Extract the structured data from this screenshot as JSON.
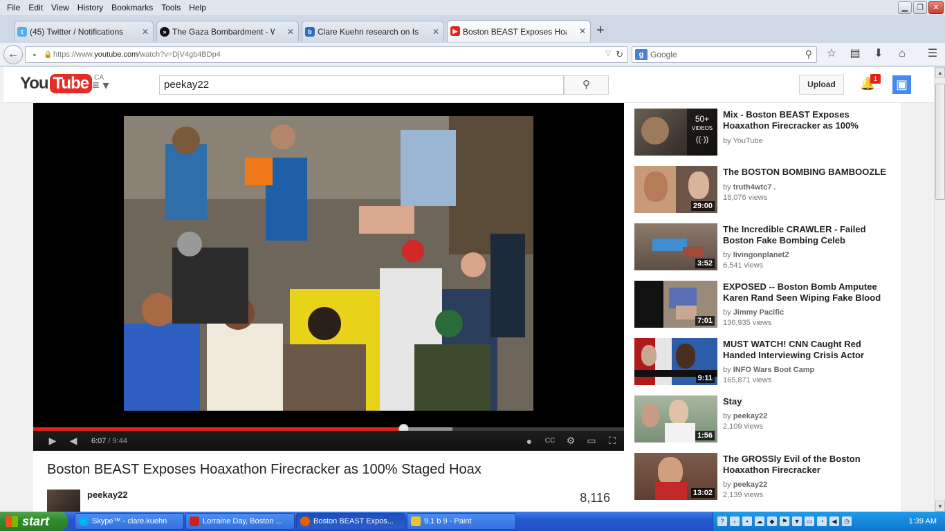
{
  "menubar": {
    "items": [
      "File",
      "Edit",
      "View",
      "History",
      "Bookmarks",
      "Tools",
      "Help"
    ]
  },
  "tabs": [
    {
      "label": "(45) Twitter / Notifications",
      "icon": "twitter-icon",
      "color": "#55acee"
    },
    {
      "label": "The Gaza Bombardment - Wh...",
      "icon": "circle-icon",
      "color": "#111111"
    },
    {
      "label": "Clare Kuehn research on Is P...",
      "icon": "blog-icon",
      "color": "#2c6fb8"
    },
    {
      "label": "Boston BEAST Exposes Hoax...",
      "icon": "youtube-icon",
      "color": "#e62117"
    }
  ],
  "urlbar": {
    "prefix": "https://www.",
    "host": "youtube.com",
    "path": "/watch?v=DjV4gb4BDp4"
  },
  "searchbar": {
    "placeholder": "Google"
  },
  "youtube": {
    "logo_you": "You",
    "logo_tube": "Tube",
    "region": "CA",
    "search_value": "peekay22",
    "upload_label": "Upload",
    "notification_count": "1"
  },
  "player": {
    "current_time": "6:07",
    "total_time": "/ 9:44",
    "progress_fraction": 0.627,
    "buffered_fraction": 0.71
  },
  "video": {
    "title": "Boston BEAST Exposes Hoaxathon Firecracker as 100% Staged Hoax",
    "channel": "peekay22",
    "views": "8,116"
  },
  "related": [
    {
      "title": "Mix - Boston BEAST Exposes Hoaxathon Firecracker as 100%",
      "by": "by ",
      "channel": "YouTube",
      "views": "",
      "duration": "",
      "overlay_count": "50+",
      "overlay_label": "VIDEOS"
    },
    {
      "title": "The BOSTON BOMBING BAMBOOZLE",
      "by": "by ",
      "channel": "truth4wtc7 .",
      "views": "18,076 views",
      "duration": "29:00"
    },
    {
      "title": "The Incredible CRAWLER - Failed Boston Fake Bombing Celeb",
      "by": "by ",
      "channel": "livingonplanetZ",
      "views": "6,541 views",
      "duration": "3:52"
    },
    {
      "title": "EXPOSED -- Boston Bomb Amputee Karen Rand Seen Wiping Fake Blood",
      "by": "by ",
      "channel": "Jimmy Pacific",
      "views": "136,935 views",
      "duration": "7:01"
    },
    {
      "title": "MUST WATCH! CNN Caught Red Handed Interviewing Crisis Actor",
      "by": "by ",
      "channel": "INFO Wars Boot Camp",
      "views": "165,871 views",
      "duration": "9:11"
    },
    {
      "title": "Stay",
      "by": "by ",
      "channel": "peekay22",
      "views": "2,109 views",
      "duration": "1:56"
    },
    {
      "title": "The GROSSly Evil of the Boston Hoaxathon Firecracker",
      "by": "by ",
      "channel": "peekay22",
      "views": "2,139 views",
      "duration": "13:02"
    }
  ],
  "taskbar": {
    "start_label": "start",
    "items": [
      {
        "label": "Skype™ - clare.kuehn",
        "color": "#00aff0"
      },
      {
        "label": "Lorraine Day, Boston ...",
        "color": "#cc2222"
      },
      {
        "label": "Boston BEAST Expos...",
        "color": "#e66000"
      },
      {
        "label": "9.1 b 9 - Paint",
        "color": "#f2c230"
      }
    ],
    "clock": "1:39 AM"
  }
}
